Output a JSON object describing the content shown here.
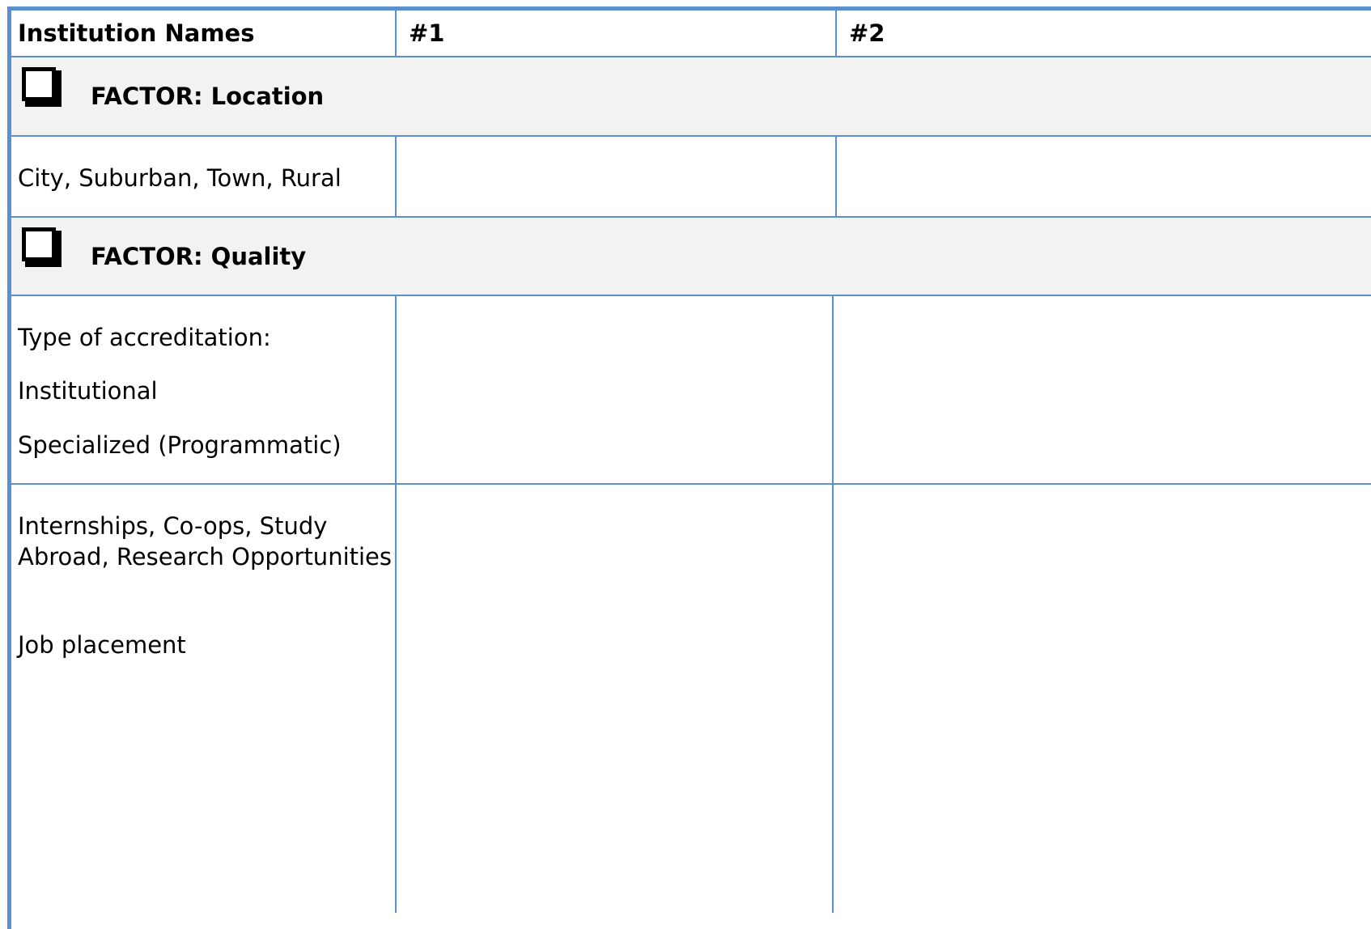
{
  "header": {
    "col0": "Institution Names",
    "col1": "#1",
    "col2": "#2"
  },
  "sections": [
    {
      "factor_label": "FACTOR: Location",
      "checkbox_icon": "checkbox-icon",
      "rows": [
        {
          "lines": [
            "City, Suburban, Town, Rural"
          ]
        }
      ]
    },
    {
      "factor_label": "FACTOR: Quality",
      "checkbox_icon": "checkbox-icon",
      "rows": [
        {
          "lines": [
            "Type of accreditation:",
            "Institutional",
            "Specialized (Programmatic)"
          ]
        },
        {
          "lines": [
            "Internships, Co-ops, Study",
            "Abroad, Research Opportunities",
            "Job placement"
          ]
        }
      ]
    }
  ],
  "colors": {
    "border": "#5b8fd0",
    "shade": "#f2f2f2"
  }
}
